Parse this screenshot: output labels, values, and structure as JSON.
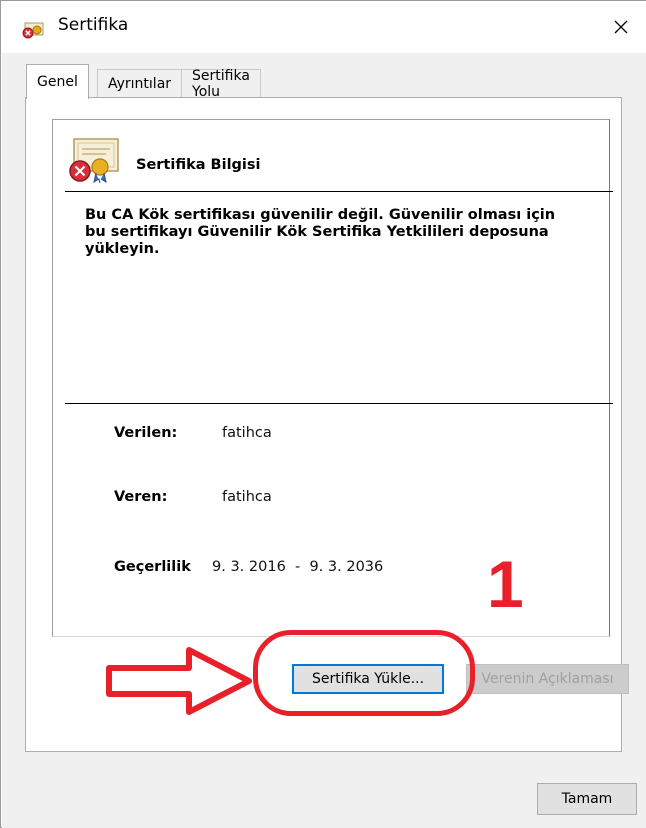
{
  "window": {
    "title": "Sertifika"
  },
  "tabs": [
    {
      "label": "Genel"
    },
    {
      "label": "Ayrıntılar"
    },
    {
      "label": "Sertifika Yolu"
    }
  ],
  "info": {
    "heading": "Sertifika Bilgisi",
    "warning": "Bu CA Kök sertifikası güvenilir değil. Güvenilir olması için bu sertifikayı Güvenilir Kök Sertifika Yetkilileri deposuna yükleyin.",
    "issued_to_label": "Verilen:",
    "issued_to_value": "fatihca",
    "issued_by_label": "Veren:",
    "issued_by_value": "fatihca",
    "validity_label": "Geçerlilik",
    "validity_value": "9. 3. 2016  -  9. 3. 2036"
  },
  "buttons": {
    "install": "Sertifika Yükle...",
    "issuer_statement": "Verenin Açıklaması",
    "ok": "Tamam"
  },
  "annotation": {
    "number": "1",
    "color": "#e8202a"
  }
}
